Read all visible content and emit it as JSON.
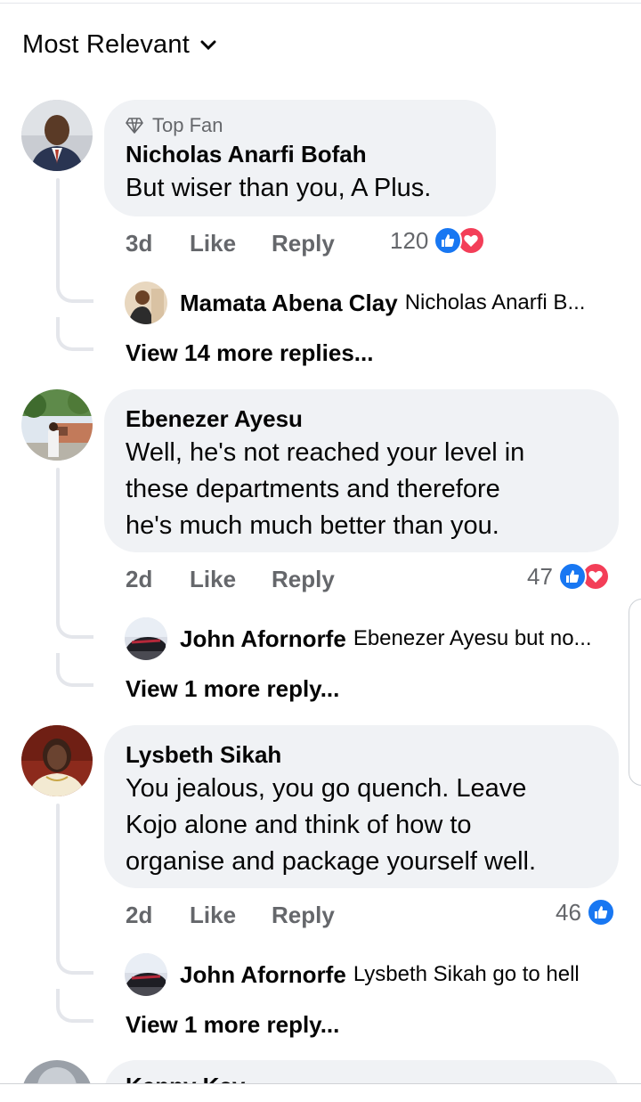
{
  "sort": {
    "label": "Most Relevant"
  },
  "comments": [
    {
      "badge": "Top Fan",
      "author": "Nicholas Anarfi Bofah",
      "text": "But wiser than you, A Plus.",
      "time": "3d",
      "like_label": "Like",
      "reply_label": "Reply",
      "reaction_count": "120",
      "reactions": [
        "like-icon",
        "love-icon"
      ],
      "reply_preview": {
        "author": "Mamata Abena Clay",
        "text": "Nicholas Anarfi B..."
      },
      "more_replies": "View 14 more replies..."
    },
    {
      "author": "Ebenezer Ayesu",
      "text_lines": [
        "Well, he's not reached your level in",
        "these departments and therefore",
        "he's much much better than you."
      ],
      "time": "2d",
      "like_label": "Like",
      "reply_label": "Reply",
      "reaction_count": "47",
      "reactions": [
        "like-icon",
        "love-icon"
      ],
      "reply_preview": {
        "author": "John Afornorfe",
        "text": "Ebenezer Ayesu but no..."
      },
      "more_replies": "View 1 more reply..."
    },
    {
      "author": "Lysbeth Sikah",
      "text_lines": [
        "You jealous, you go quench. Leave",
        "Kojo alone and think of how to",
        "organise and package yourself well."
      ],
      "time": "2d",
      "like_label": "Like",
      "reply_label": "Reply",
      "reaction_count": "46",
      "reactions": [
        "like-icon"
      ],
      "reply_preview": {
        "author": "John Afornorfe",
        "text": "Lysbeth Sikah go to hell"
      },
      "more_replies": "View 1 more reply..."
    },
    {
      "author": "Kenny Kay"
    }
  ],
  "colors": {
    "bubble": "#f0f2f5",
    "like": "#1877f2",
    "love": "#f33e58",
    "meta": "#65676b"
  }
}
